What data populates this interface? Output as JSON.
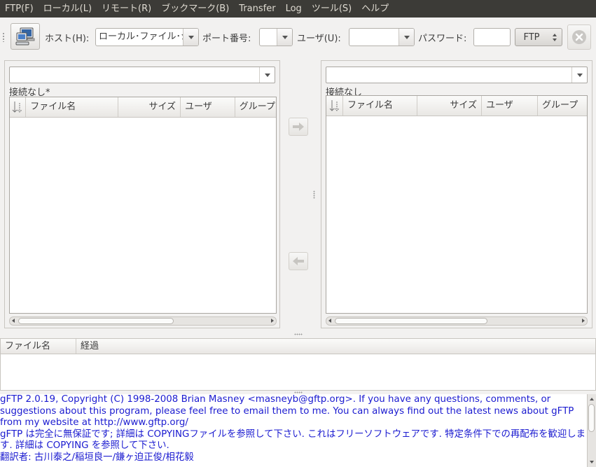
{
  "menu": [
    {
      "label": "FTP(F)"
    },
    {
      "label": "ローカル(L)"
    },
    {
      "label": "リモート(R)"
    },
    {
      "label": "ブックマーク(B)"
    },
    {
      "label": "Transfer"
    },
    {
      "label": "Log"
    },
    {
      "label": "ツール(S)"
    },
    {
      "label": "ヘルプ"
    }
  ],
  "toolbar": {
    "host_label": "ホスト(H):",
    "host_value": "ローカル･ファイル･システム",
    "port_label": "ポート番号:",
    "user_label": "ユーザ(U):",
    "password_label": "パスワード:",
    "protocol_value": "FTP"
  },
  "local_pane": {
    "status": "接続なし*",
    "columns": [
      "ファイル名",
      "サイズ",
      "ユーザ",
      "グループ"
    ]
  },
  "remote_pane": {
    "status": "接続なし",
    "columns": [
      "ファイル名",
      "サイズ",
      "ユーザ",
      "グループ"
    ]
  },
  "transfer": {
    "columns": [
      "ファイル名",
      "経過"
    ]
  },
  "log": {
    "lines": [
      "gFTP 2.0.19, Copyright (C) 1998-2008 Brian Masney <masneyb@gftp.org>. If you have any questions, comments, or suggestions about this program, please feel free to email them to me. You can always find out the latest news about gFTP from my website at http://www.gftp.org/",
      "gFTP は完全に無保証です; 詳細は COPYINGファイルを参照して下さい. これはフリーソフトウェアです. 特定条件下での再配布を歓迎します. 詳細は COPYING を参照して下さい.",
      "翻訳者: 古川泰之/稲垣良一/鎌ヶ迫正俊/相花毅"
    ]
  },
  "colors": {
    "menubar_bg": "#3c3b37",
    "log_text": "#1b1bd0",
    "window_bg": "#f2f1f0"
  }
}
